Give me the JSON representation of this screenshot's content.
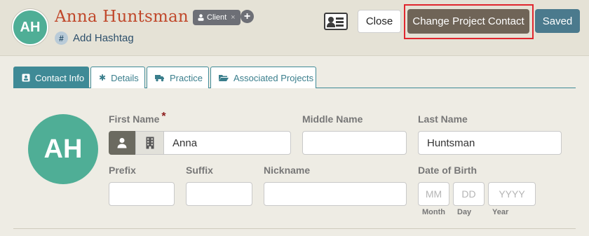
{
  "header": {
    "avatar_initials": "AH",
    "name": "Anna Huntsman",
    "badge": "Client",
    "badge_remove": "×",
    "add_tag_symbol": "+",
    "hashtag_symbol": "#",
    "hashtag_label": "Add Hashtag",
    "buttons": {
      "close": "Close",
      "change_contact": "Change Project Contact",
      "saved": "Saved"
    }
  },
  "tabs": [
    {
      "label": "Contact Info",
      "icon": "id-card-icon",
      "active": true
    },
    {
      "label": "Details",
      "icon": "asterisk-icon",
      "active": false
    },
    {
      "label": "Practice",
      "icon": "truck-icon",
      "active": false
    },
    {
      "label": "Associated Projects",
      "icon": "folder-open-icon",
      "active": false
    }
  ],
  "form": {
    "avatar_initials": "AH",
    "first_name_label": "First Name",
    "required_mark": "*",
    "first_name_value": "Anna",
    "middle_name_label": "Middle Name",
    "middle_name_value": "",
    "last_name_label": "Last Name",
    "last_name_value": "Huntsman",
    "prefix_label": "Prefix",
    "suffix_label": "Suffix",
    "nickname_label": "Nickname",
    "dob_label": "Date of Birth",
    "dob": {
      "month_placeholder": "MM",
      "day_placeholder": "DD",
      "year_placeholder": "YYYY",
      "month_label": "Month",
      "day_label": "Day",
      "year_label": "Year"
    }
  },
  "colors": {
    "accent_teal": "#3f8a96",
    "name_red": "#c0482b",
    "avatar_green": "#4fae96",
    "change_button": "#6f6457",
    "saved_button": "#4b7a8d",
    "highlight": "#e0262e"
  }
}
